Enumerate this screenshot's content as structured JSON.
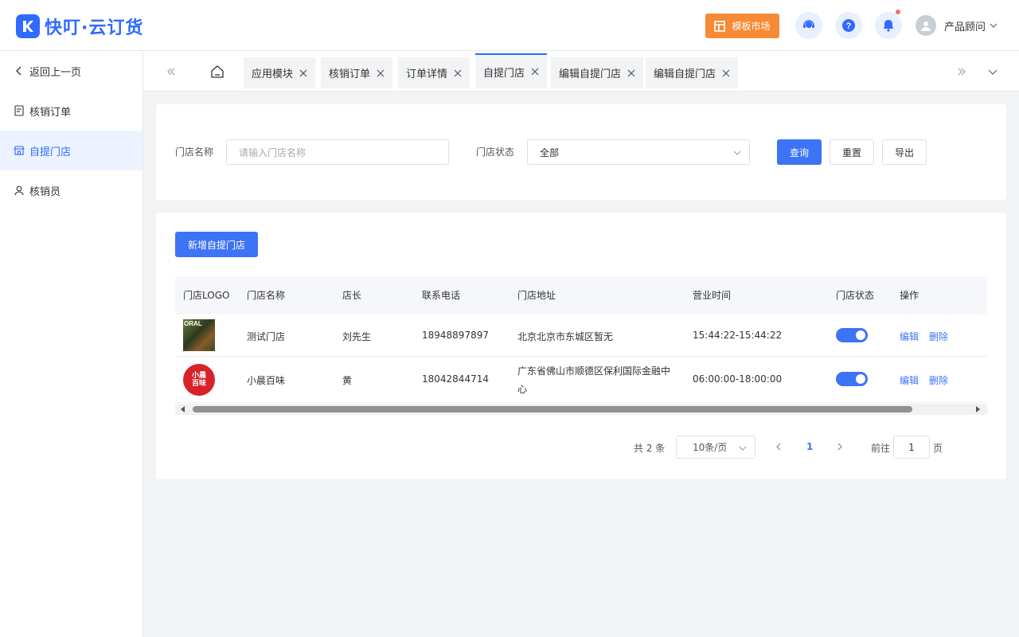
{
  "header": {
    "logo_text": "快叮·云订货",
    "template_market": "模板市场",
    "user_name": "产品顾问"
  },
  "sidebar": {
    "items": [
      {
        "label": "返回上一页"
      },
      {
        "label": "核销订单"
      },
      {
        "label": "自提门店"
      },
      {
        "label": "核销员"
      }
    ]
  },
  "tabs": [
    {
      "label": "应用模块"
    },
    {
      "label": "核销订单"
    },
    {
      "label": "订单详情"
    },
    {
      "label": "自提门店"
    },
    {
      "label": "编辑自提门店"
    },
    {
      "label": "编辑自提门店"
    }
  ],
  "filter": {
    "store_name_label": "门店名称",
    "store_name_placeholder": "请输入门店名称",
    "status_label": "门店状态",
    "status_value": "全部",
    "query": "查询",
    "reset": "重置",
    "export": "导出"
  },
  "list": {
    "add_button": "新增自提门店",
    "columns": [
      "门店LOGO",
      "门店名称",
      "店长",
      "联系电话",
      "门店地址",
      "营业时间",
      "门店状态",
      "操作"
    ],
    "rows": [
      {
        "name": "测试门店",
        "manager": "刘先生",
        "phone": "18948897897",
        "address": "北京北京市东城区暂无",
        "address2": "",
        "hours": "15:44:22-15:44:22",
        "enabled": true,
        "edit": "编辑",
        "delete": "删除",
        "logo_text": "ORAL"
      },
      {
        "name": "小晨百味",
        "manager": "黄",
        "phone": "18042844714",
        "address": "广东省佛山市顺德区保利国际金融中",
        "address2": "心",
        "hours": "06:00:00-18:00:00",
        "enabled": true,
        "edit": "编辑",
        "delete": "删除",
        "logo_text": "小晨百味"
      }
    ]
  },
  "pagination": {
    "total": "共 2 条",
    "page_size": "10条/页",
    "current_page": "1",
    "goto_label": "前往",
    "goto_value": "1",
    "page_unit": "页"
  },
  "colors": {
    "primary": "#3d73f5",
    "orange": "#f68a35"
  }
}
